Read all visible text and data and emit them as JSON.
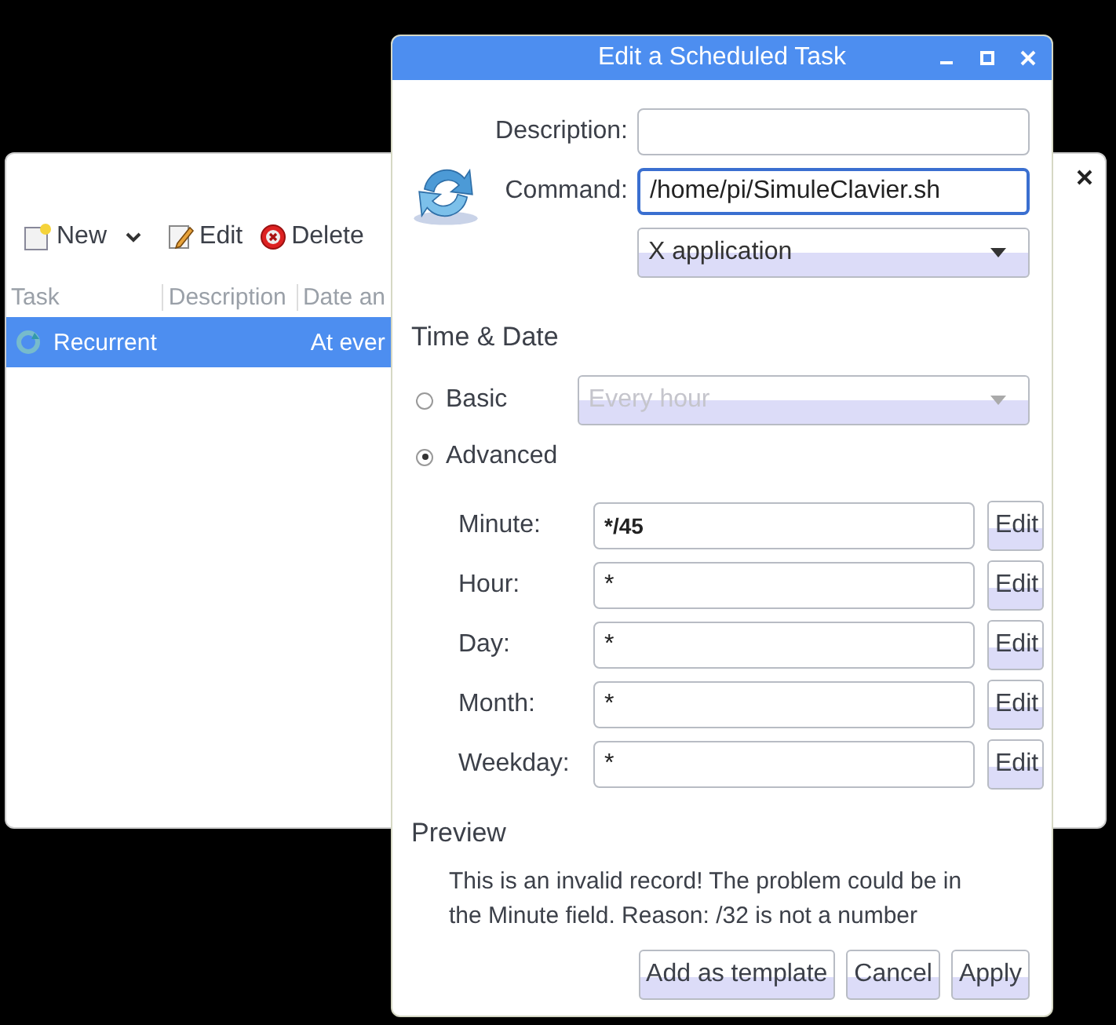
{
  "back_window": {
    "toolbar": [
      {
        "kind": "new",
        "label": "New"
      },
      {
        "kind": "dropdown"
      },
      {
        "kind": "edit",
        "label": "Edit"
      },
      {
        "kind": "delete",
        "label": "Delete"
      }
    ],
    "columns": [
      "Task",
      "Description",
      "Date an"
    ],
    "rows": [
      {
        "task": "Recurrent",
        "date": "At ever",
        "selected": true
      }
    ]
  },
  "dialog": {
    "title": "Edit a Scheduled Task",
    "description": {
      "label": "Description:"
    },
    "command": {
      "label": "Command:",
      "value": "/home/pi/SimuleClavier.sh",
      "focused": true
    },
    "type_select": "X application",
    "section_title": "Time & Date",
    "modes": [
      {
        "label": "Basic",
        "selected": false,
        "select_value": "Every hour",
        "select_disabled": true
      },
      {
        "label": "Advanced",
        "selected": true
      }
    ],
    "fields": [
      {
        "label": "Minute:",
        "value": "*/45",
        "bold": true,
        "button": "Edit"
      },
      {
        "label": "Hour:",
        "value": "*",
        "bold": false,
        "button": "Edit"
      },
      {
        "label": "Day:",
        "value": "*",
        "bold": false,
        "button": "Edit"
      },
      {
        "label": "Month:",
        "value": "*",
        "bold": false,
        "button": "Edit"
      },
      {
        "label": "Weekday:",
        "value": "*",
        "bold": false,
        "button": "Edit"
      }
    ],
    "preview_title": "Preview",
    "preview_text": "This is an invalid record! The problem could be in the Minute field. Reason: /32 is not a number",
    "buttons": [
      "Add as template",
      "Cancel",
      "Apply"
    ]
  }
}
